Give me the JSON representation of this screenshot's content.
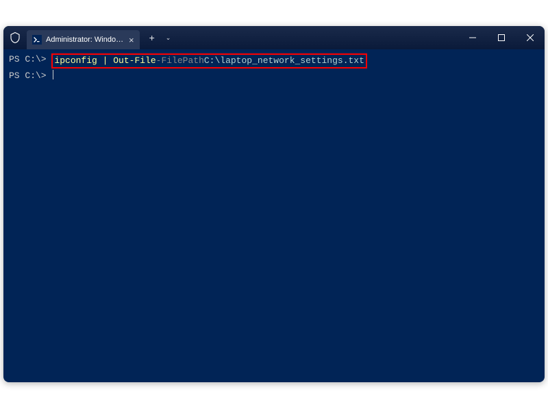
{
  "titlebar": {
    "tab_title": "Administrator: Windows Powe",
    "close_label": "×",
    "new_tab_label": "+",
    "dropdown_label": "⌄",
    "minimize_label": "—",
    "maximize_label": "☐",
    "window_close_label": "×"
  },
  "terminal": {
    "line1": {
      "prompt": "PS C:\\> ",
      "cmd_part1": "ipconfig | Out-File ",
      "cmd_param": "-FilePath",
      "cmd_space": " ",
      "cmd_path": "C:\\laptop_network_settings.txt"
    },
    "line2": {
      "prompt": "PS C:\\> "
    }
  },
  "colors": {
    "terminal_bg": "#012456",
    "titlebar_bg": "#1a2a4a",
    "highlight_border": "#ff0000"
  }
}
